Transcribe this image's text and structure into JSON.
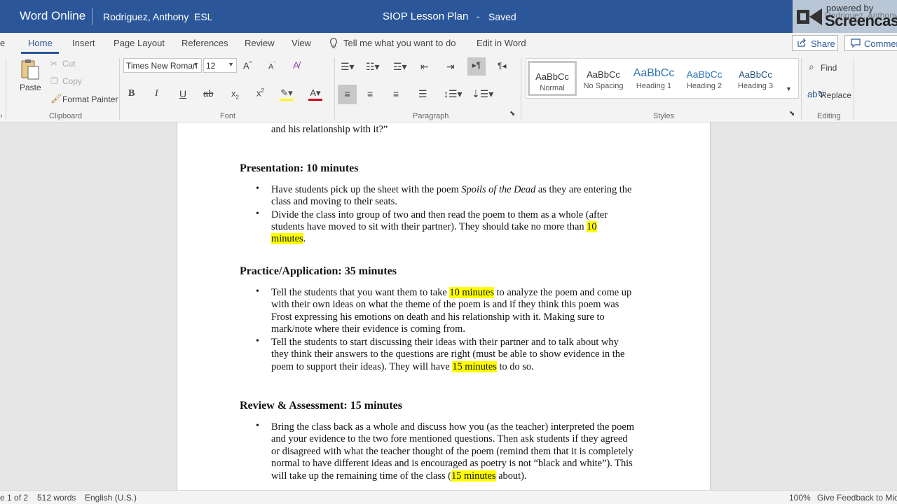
{
  "titlebar": {
    "app_name": "Word Online",
    "breadcrumb_user": "Rodriguez, Anthony",
    "breadcrumb_folder": "ESL",
    "doc_title": "SIOP Lesson Plan",
    "separator": "-",
    "save_status": "Saved"
  },
  "watermark": {
    "powered_by": "powered by",
    "brand": "Screencast",
    "owner": "Rodriguez, Anthony"
  },
  "menu": {
    "file_partial": "e",
    "home": "Home",
    "insert": "Insert",
    "page_layout": "Page Layout",
    "references": "References",
    "review": "Review",
    "view": "View",
    "tell_me": "Tell me what you want to do",
    "edit_in_word": "Edit in Word",
    "share": "Share",
    "comments": "Comments"
  },
  "ribbon": {
    "clipboard": {
      "paste": "Paste",
      "cut": "Cut",
      "copy": "Copy",
      "format_painter": "Format Painter",
      "label": "Clipboard"
    },
    "font": {
      "family": "Times New Roman",
      "size": "12",
      "label": "Font"
    },
    "paragraph": {
      "label": "Paragraph"
    },
    "styles": {
      "label": "Styles",
      "items": [
        {
          "sample": "AaBbCc",
          "name": "Normal"
        },
        {
          "sample": "AaBbCc",
          "name": "No Spacing"
        },
        {
          "sample": "AaBbCc",
          "name": "Heading 1"
        },
        {
          "sample": "AaBbCc",
          "name": "Heading 2"
        },
        {
          "sample": "AaBbCc",
          "name": "Heading 3"
        }
      ]
    },
    "editing": {
      "find": "Find",
      "replace": "Replace",
      "label": "Editing"
    }
  },
  "document": {
    "top_line": "and his relationship with it?”",
    "presentation_heading": "Presentation: 10 minutes",
    "p_b1_l1_a": "Have students pick up the sheet with the poem ",
    "p_b1_l1_italic": "Spoils of the Dead",
    "p_b1_l1_b": " as they are entering the",
    "p_b1_l2": "class and moving to their seats.",
    "p_b2_l1": "Divide the class into group of two and then read the poem to them as a whole (after",
    "p_b2_l2_a": "students have moved to sit with their partner). They should take no more than ",
    "p_b2_l2_hl": "10",
    "p_b2_l3_hl": "minutes",
    "p_b2_l3_b": ".",
    "practice_heading": "Practice/Application: 35 minutes",
    "pr_b1_l1_a": "Tell the students that you want them to take ",
    "pr_b1_l1_hl": "10 minutes",
    "pr_b1_l1_b": " to analyze the poem and come up",
    "pr_b1_l2": "with their own ideas on what the theme of the poem is and if they think this poem was",
    "pr_b1_l3": "Frost expressing his emotions on death and his relationship with it. Making sure to",
    "pr_b1_l4": "mark/note where their evidence is coming from.",
    "pr_b2_l1": "Tell the students to start discussing their ideas with their partner and to talk about why",
    "pr_b2_l2": "they think their answers to the questions are right (must be able to show evidence in the",
    "pr_b2_l3_a": "poem to support their ideas). They will have ",
    "pr_b2_l3_hl": "15 minutes",
    "pr_b2_l3_b": " to do so.",
    "review_heading": "Review & Assessment: 15 minutes",
    "r_b1_l1": "Bring the class back as a whole and discuss how you (as the teacher) interpreted the poem",
    "r_b1_l2": "and your evidence to the two fore mentioned questions. Then ask students if they agreed",
    "r_b1_l3": "or disagreed with what the teacher thought of the poem (remind them that it is completely",
    "r_b1_l4": "normal to have different ideas and is encouraged as poetry is not “black and white”). This",
    "r_b1_l5_a": "will take up the remaining time of the class (",
    "r_b1_l5_hl": "15 minutes",
    "r_b1_l5_b": " about).",
    "bullet": "•"
  },
  "statusbar": {
    "page": "e 1 of 2",
    "words": "512 words",
    "language": "English (U.S.)",
    "zoom": "100%",
    "feedback": "Give Feedback to Microsoft"
  },
  "colors": {
    "brand": "#2b579a",
    "highlight": "#ffff00"
  }
}
